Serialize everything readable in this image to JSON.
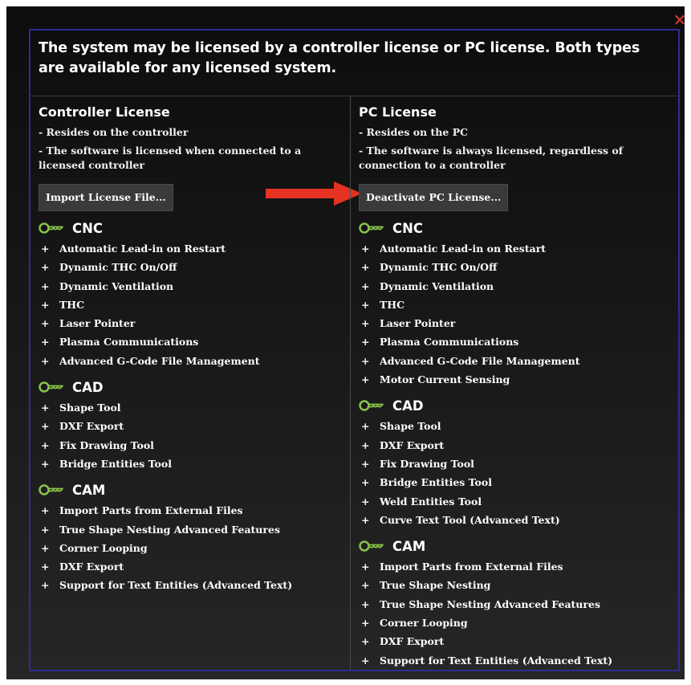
{
  "close_glyph": "×",
  "header": {
    "text": "The system may be licensed by a controller license or PC license.  Both types are available for any licensed system."
  },
  "left": {
    "title": "Controller License",
    "desc1": "- Resides on the controller",
    "desc2": "- The software is licensed when connected to a licensed controller",
    "button_label": "Import License File...",
    "sections": [
      {
        "title": "CNC",
        "items": [
          "Automatic Lead-in on Restart",
          "Dynamic THC On/Off",
          "Dynamic Ventilation",
          "THC",
          "Laser Pointer",
          "Plasma Communications",
          "Advanced G-Code File Management"
        ]
      },
      {
        "title": "CAD",
        "items": [
          "Shape Tool",
          "DXF Export",
          "Fix Drawing Tool",
          "Bridge Entities Tool"
        ]
      },
      {
        "title": "CAM",
        "items": [
          "Import Parts from External Files",
          "True Shape Nesting Advanced Features",
          "Corner Looping",
          "DXF Export",
          "Support for Text Entities (Advanced Text)"
        ]
      }
    ]
  },
  "right": {
    "title": "PC License",
    "desc1": "- Resides on the PC",
    "desc2": "- The software is always licensed, regardless of connection to a controller",
    "button_label": "Deactivate PC License...",
    "sections": [
      {
        "title": "CNC",
        "items": [
          "Automatic Lead-in on Restart",
          "Dynamic THC On/Off",
          "Dynamic Ventilation",
          "THC",
          "Laser Pointer",
          "Plasma Communications",
          "Advanced G-Code File Management",
          "Motor Current Sensing"
        ]
      },
      {
        "title": "CAD",
        "items": [
          "Shape Tool",
          "DXF Export",
          "Fix Drawing Tool",
          "Bridge Entities Tool",
          "Weld Entities Tool",
          "Curve Text Tool (Advanced Text)"
        ]
      },
      {
        "title": "CAM",
        "items": [
          "Import Parts from External Files",
          "True Shape Nesting",
          "True Shape Nesting Advanced Features",
          "Corner Looping",
          "DXF Export",
          "Support for Text Entities (Advanced Text)"
        ]
      }
    ]
  },
  "bullet": "+",
  "icons": {
    "section": "key-icon",
    "pointer": "red-arrow-icon",
    "close": "close-icon"
  },
  "colors": {
    "key": "#8bc34a",
    "arrow": "#e53222",
    "border": "#2d2f8f",
    "close": "#c0392b"
  }
}
